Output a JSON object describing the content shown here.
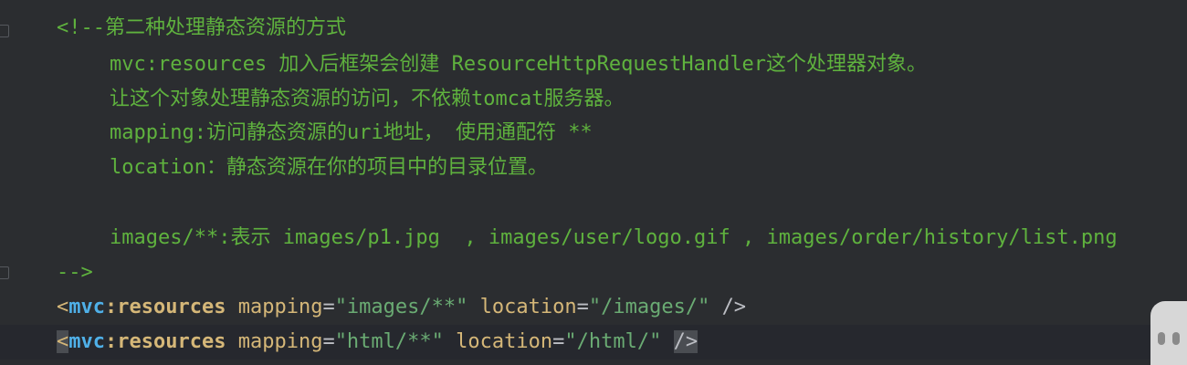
{
  "editor": {
    "comment_open": "<!--第二种处理静态资源的方式",
    "comment_lines": [
      "mvc:resources 加入后框架会创建 ResourceHttpRequestHandler这个处理器对象。",
      "让这个对象处理静态资源的访问，不依赖tomcat服务器。",
      "mapping:访问静态资源的uri地址， 使用通配符 **",
      "location：静态资源在你的项目中的目录位置。",
      "",
      "images/**:表示 images/p1.jpg  , images/user/logo.gif , images/order/history/list.png"
    ],
    "comment_close": "-->",
    "xml_lines": [
      {
        "open": "<",
        "ns": "mvc",
        "colon": ":",
        "name": "resources",
        "attr1": "mapping",
        "val1": "\"images/**\"",
        "attr2": "location",
        "val2": "\"/images/\"",
        "close": "/>"
      },
      {
        "open": "<",
        "ns": "mvc",
        "colon": ":",
        "name": "resources",
        "attr1": "mapping",
        "val1": "\"html/**\"",
        "attr2": "location",
        "val2": "\"/html/\"",
        "close": "/>"
      }
    ]
  },
  "colors": {
    "background": "#2b2d30",
    "comment": "#5fb23e",
    "tag": "#d5b778",
    "namespace": "#4fb0e8",
    "value": "#6aab73"
  }
}
